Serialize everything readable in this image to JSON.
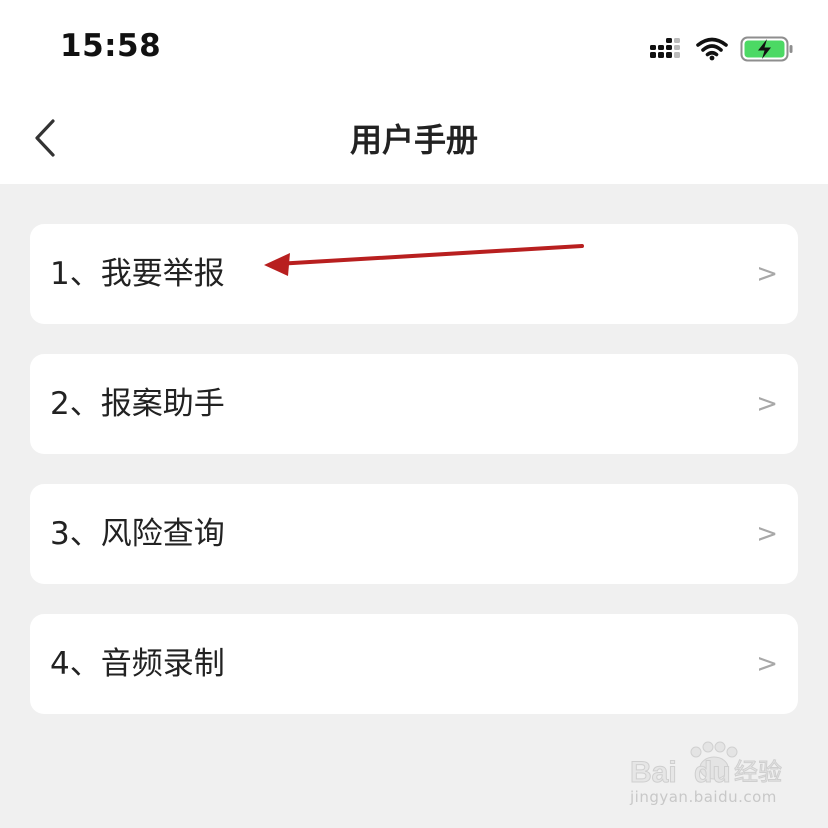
{
  "status_bar": {
    "time": "15:58",
    "icons": [
      "signal-icon",
      "wifi-icon",
      "battery-charging-icon"
    ],
    "battery_color": "#4cd964"
  },
  "nav": {
    "title": "用户手册",
    "back_icon": "chevron-left-icon"
  },
  "menu": {
    "items": [
      {
        "label": "1、我要举报",
        "chevron": ">"
      },
      {
        "label": "2、报案助手",
        "chevron": ">"
      },
      {
        "label": "3、风险查询",
        "chevron": ">"
      },
      {
        "label": "4、音频录制",
        "chevron": ">"
      }
    ]
  },
  "annotation": {
    "arrow_color": "#b81f1f"
  },
  "watermark": {
    "logo_text": "Baidu经验",
    "url": "jingyan.baidu.com"
  },
  "colors": {
    "page_background": "#f0f0f0",
    "card_background": "#ffffff",
    "chevron": "#a8a8a8"
  }
}
